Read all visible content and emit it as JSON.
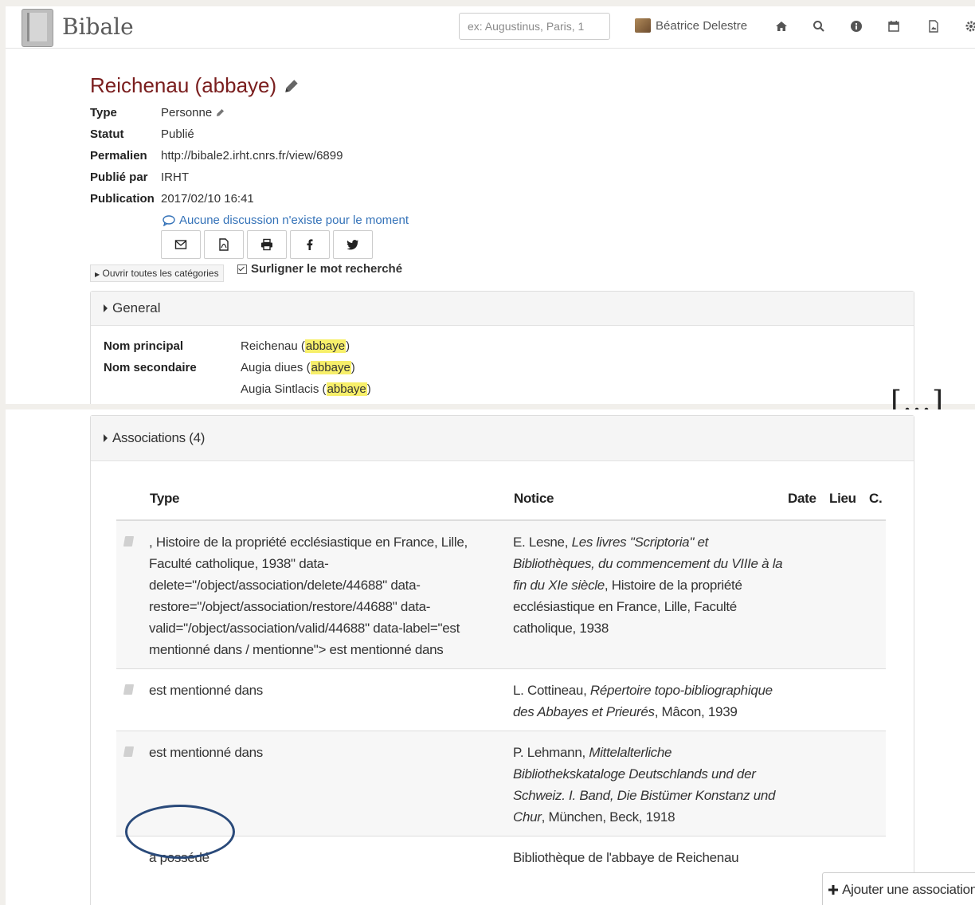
{
  "navbar": {
    "brand": "Bibale",
    "search_placeholder": "ex: Augustinus, Paris, 1",
    "user_name": "Béatrice Delestre"
  },
  "record": {
    "title": "Reichenau (abbaye)",
    "meta": [
      {
        "key": "Type",
        "value": "Personne"
      },
      {
        "key": "Statut",
        "value": "Publié"
      },
      {
        "key": "Permalien",
        "value": "http://bibale2.irht.cnrs.fr/view/6899"
      },
      {
        "key": "Publié par",
        "value": "IRHT"
      },
      {
        "key": "Publication",
        "value": "2017/02/10 16:41"
      }
    ],
    "discussion": "Aucune discussion n'existe pour le moment",
    "open_all": "Ouvrir toutes les catégories",
    "highlight_label": "Surligner le mot recherché"
  },
  "general": {
    "heading": "General",
    "primary_label": "Nom principal",
    "secondary_label": "Nom secondaire",
    "primary_name": {
      "text": "Reichenau",
      "qualifier": "abbaye"
    },
    "secondary_names": [
      {
        "text": "Augia diues",
        "qualifier": "abbaye"
      },
      {
        "text": "Augia Sintlacis",
        "qualifier": "abbaye"
      }
    ]
  },
  "ellipsis": "[…]",
  "associations": {
    "heading": "Associations (4)",
    "columns": [
      "Type",
      "Notice",
      "Date",
      "Lieu",
      "C."
    ],
    "rows": [
      {
        "type": ", Histoire de la propriété ecclésiastique en France, Lille, Faculté catholique, 1938\" data-delete=\"/object/association/delete/44688\" data-restore=\"/object/association/restore/44688\" data-valid=\"/object/association/valid/44688\" data-label=\"est mentionné dans / mentionne\"> est mentionné dans",
        "notice_author": "E. Lesne, ",
        "notice_title": "Les livres \"Scriptoria\" et Bibliothèques, du commencement du VIIIe à la fin du XIe siècle",
        "notice_rest": ", Histoire de la propriété ecclésiastique en France, Lille, Faculté catholique, 1938"
      },
      {
        "type": "est mentionné dans",
        "notice_author": "L. Cottineau, ",
        "notice_title": "Répertoire topo-bibliographique des Abbayes et Prieurés",
        "notice_rest": ", Mâcon, 1939"
      },
      {
        "type": "est mentionné dans",
        "notice_author": "P. Lehmann, ",
        "notice_title": "Mittelalterliche Bibliothekskataloge Deutschlands und der Schweiz. I. Band, Die Bistümer Konstanz und Chur",
        "notice_rest": ", München, Beck, 1918"
      },
      {
        "type": "a possédé",
        "notice_author": "",
        "notice_title": "",
        "notice_rest": "Bibliothèque de l'abbaye de Reichenau"
      }
    ],
    "add_button": "Ajouter une association"
  }
}
